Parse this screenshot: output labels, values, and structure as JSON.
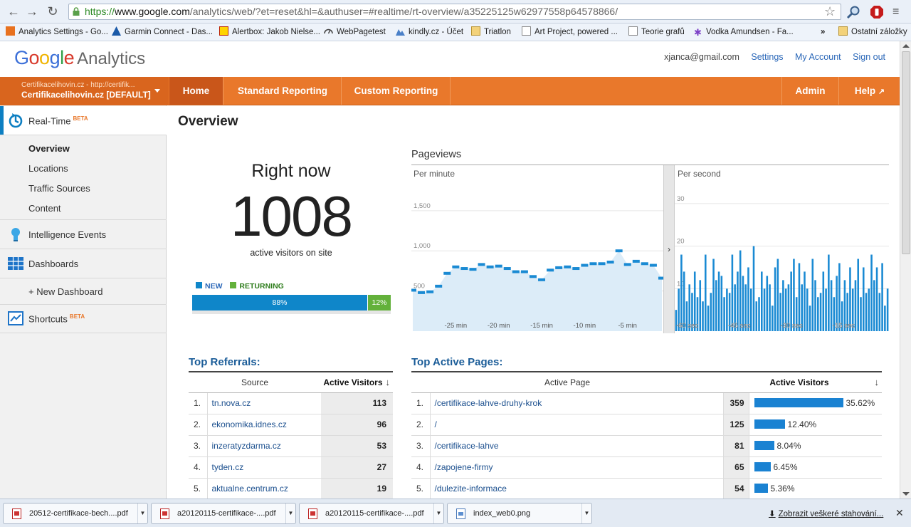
{
  "browser": {
    "url_scheme": "https://",
    "url_host": "www.google.com",
    "url_path": "/analytics/web/?et=reset&hl=&authuser=#realtime/rt-overview/a35225125w62977558p64578866/",
    "bookmarks": [
      {
        "label": "Analytics Settings - Go..."
      },
      {
        "label": "Garmin Connect - Das..."
      },
      {
        "label": "Alertbox: Jakob Nielse..."
      },
      {
        "label": "WebPagetest"
      },
      {
        "label": "kindly.cz - Účet"
      },
      {
        "label": "Triatlon"
      },
      {
        "label": "Art Project, powered ..."
      },
      {
        "label": "Teorie grafů"
      },
      {
        "label": "Vodka Amundsen - Fa..."
      },
      {
        "label": "Ostatní záložky"
      }
    ],
    "more_bookmarks": "»"
  },
  "header": {
    "logo_google": "Google",
    "logo_product": "Analytics",
    "email": "xjanca@gmail.com",
    "settings": "Settings",
    "my_account": "My Account",
    "sign_out": "Sign out"
  },
  "account": {
    "profile_url": "Certifikacelihovin.cz - http://certifik...",
    "profile_name": "Certifikacelihovin.cz [DEFAULT]"
  },
  "nav": {
    "home": "Home",
    "standard": "Standard Reporting",
    "custom": "Custom Reporting",
    "admin": "Admin",
    "help": "Help"
  },
  "sidebar": {
    "realtime": "Real-Time",
    "beta": "BETA",
    "sub": [
      "Overview",
      "Locations",
      "Traffic Sources",
      "Content"
    ],
    "intelligence": "Intelligence Events",
    "dashboards": "Dashboards",
    "new_dashboard": "+ New Dashboard",
    "shortcuts": "Shortcuts"
  },
  "main": {
    "title": "Overview",
    "right_now": "Right now",
    "count": "1008",
    "active_label": "active visitors on site",
    "legend_new": "NEW",
    "legend_returning": "RETURNING",
    "new_pct_label": "88%",
    "ret_pct_label": "12%",
    "new_fraction": 0.88,
    "pageviews_title": "Pageviews",
    "per_minute": "Per minute",
    "per_second": "Per second",
    "gutter_arrow": "›",
    "referrals_title": "Top Referrals:",
    "pages_title": "Top Active Pages:"
  },
  "referrals": {
    "col_source": "Source",
    "col_visitors": "Active Visitors",
    "sort_icon": "↓",
    "rows": [
      {
        "idx": "1.",
        "source": "tn.nova.cz",
        "visitors": "113"
      },
      {
        "idx": "2.",
        "source": "ekonomika.idnes.cz",
        "visitors": "96"
      },
      {
        "idx": "3.",
        "source": "inzeratyzdarma.cz",
        "visitors": "53"
      },
      {
        "idx": "4.",
        "source": "tyden.cz",
        "visitors": "27"
      },
      {
        "idx": "5.",
        "source": "aktualne.centrum.cz",
        "visitors": "19"
      }
    ]
  },
  "pages": {
    "col_page": "Active Page",
    "col_visitors": "Active Visitors",
    "sort_icon": "↓",
    "rows": [
      {
        "idx": "1.",
        "page": "/certifikace-lahve-druhy-krok",
        "visitors": "359",
        "pct": "35.62%",
        "frac": 0.3562
      },
      {
        "idx": "2.",
        "page": "/",
        "visitors": "125",
        "pct": "12.40%",
        "frac": 0.124
      },
      {
        "idx": "3.",
        "page": "/certifikace-lahve",
        "visitors": "81",
        "pct": "8.04%",
        "frac": 0.0804
      },
      {
        "idx": "4.",
        "page": "/zapojene-firmy",
        "visitors": "65",
        "pct": "6.45%",
        "frac": 0.0645
      },
      {
        "idx": "5.",
        "page": "/dulezite-informace",
        "visitors": "54",
        "pct": "5.36%",
        "frac": 0.0536
      }
    ]
  },
  "chart_data": [
    {
      "type": "area",
      "title": "Per minute",
      "ylim": [
        0,
        1800
      ],
      "yticks": [
        "500",
        "1,000",
        "1,500"
      ],
      "ytick_values": [
        500,
        1000,
        1500
      ],
      "xticks": [
        "-25 min",
        "-20 min",
        "-15 min",
        "-10 min",
        "-5 min"
      ],
      "xtick_values": [
        -25,
        -20,
        -15,
        -10,
        -5
      ],
      "x": [
        -30,
        -29,
        -28,
        -27,
        -26,
        -25,
        -24,
        -23,
        -22,
        -21,
        -20,
        -19,
        -18,
        -17,
        -16,
        -15,
        -14,
        -13,
        -12,
        -11,
        -10,
        -9,
        -8,
        -7,
        -6,
        -5,
        -4,
        -3,
        -2,
        -1
      ],
      "values": [
        510,
        480,
        490,
        560,
        720,
        800,
        780,
        770,
        830,
        800,
        810,
        780,
        740,
        740,
        680,
        640,
        760,
        790,
        800,
        780,
        820,
        840,
        840,
        860,
        1000,
        830,
        870,
        840,
        820,
        660
      ]
    },
    {
      "type": "bar",
      "title": "Per second",
      "ylim": [
        0,
        34
      ],
      "yticks": [
        "10",
        "20",
        "30"
      ],
      "ytick_values": [
        10,
        20,
        30
      ],
      "xticks": [
        "-60 sec",
        "-45 sec",
        "-30 sec",
        "-15 sec"
      ],
      "xtick_values": [
        -60,
        -45,
        -30,
        -15
      ],
      "values": [
        5,
        10,
        18,
        14,
        7,
        11,
        9,
        14,
        8,
        12,
        7,
        18,
        6,
        9,
        17,
        12,
        14,
        13,
        8,
        10,
        9,
        18,
        11,
        14,
        19,
        13,
        11,
        15,
        10,
        20,
        7,
        8,
        14,
        10,
        13,
        11,
        6,
        15,
        17,
        9,
        12,
        10,
        11,
        14,
        17,
        8,
        16,
        11,
        14,
        10,
        6,
        17,
        12,
        8,
        9,
        14,
        10,
        18,
        12,
        8,
        13,
        16,
        7,
        12,
        9,
        15,
        10,
        12,
        17,
        8,
        15,
        9,
        10,
        18,
        12,
        15,
        9,
        16,
        6,
        10
      ]
    }
  ],
  "downloads": {
    "items": [
      {
        "name": "20512-certifikace-bech....pdf",
        "kind": "pdf"
      },
      {
        "name": "a20120115-certifikace-....pdf",
        "kind": "pdf"
      },
      {
        "name": "a20120115-certifikace-....pdf",
        "kind": "pdf"
      },
      {
        "name": "index_web0.png",
        "kind": "img"
      }
    ],
    "show_all": "Zobrazit veškeré stahování...",
    "close": "✕"
  }
}
